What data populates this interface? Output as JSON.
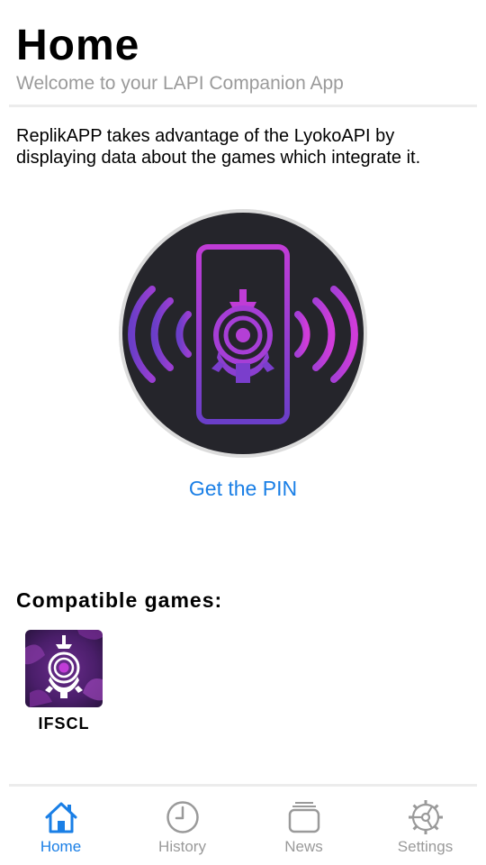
{
  "header": {
    "title": "Home",
    "subtitle": "Welcome to your LAPI Companion App"
  },
  "intro": {
    "text": "ReplikAPP takes advantage of the LyokoAPI by displaying data about the games which integrate it."
  },
  "hero": {
    "icon": "phone-signal-eye-logo",
    "colors": {
      "circle": "#25252b",
      "ring": "#d9d9d9",
      "purple_light": "#c03cd6",
      "purple_dark": "#6a3ec8"
    }
  },
  "pin_link": {
    "label": "Get the PIN",
    "color": "#1a7fe6"
  },
  "games_section": {
    "title": "Compatible games:",
    "games": [
      {
        "label": "IFSCL",
        "icon": "ifscl-game-icon"
      }
    ]
  },
  "tabbar": {
    "active_color": "#1a7fe6",
    "inactive_color": "#9a9a9a",
    "tabs": [
      {
        "label": "Home",
        "icon": "house-icon",
        "active": true
      },
      {
        "label": "History",
        "icon": "clock-icon",
        "active": false
      },
      {
        "label": "News",
        "icon": "news-stack-icon",
        "active": false
      },
      {
        "label": "Settings",
        "icon": "gear-icon",
        "active": false
      }
    ]
  }
}
